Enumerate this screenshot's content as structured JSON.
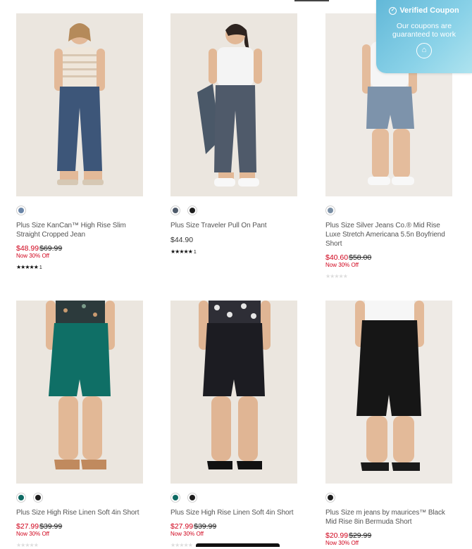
{
  "coupon": {
    "title": "Verified Coupon",
    "subtitle": "Our coupons are guaranteed to work",
    "check_icon": "check-circle-icon",
    "logo_icon": "shield-logo-icon"
  },
  "products": [
    {
      "title": "Plus Size KanCan™ High Rise Slim Straight Cropped Jean",
      "sale_price": "$48.99",
      "orig_price": "$69.99",
      "discount": "Now 30% Off",
      "stars": "★★★★★",
      "review_count": "1",
      "swatches": [
        "#6b86a8"
      ],
      "colors": {
        "top": "#efe6da",
        "bottom": "#3d5679",
        "skin": "#e3b998",
        "bg": "#ebe6df"
      }
    },
    {
      "title": "Plus Size Traveler Pull On Pant",
      "reg_price": "$44.90",
      "stars": "★★★★★",
      "review_count": "1",
      "swatches": [
        "#4f5b6b",
        "#1e1e1e"
      ],
      "colors": {
        "top": "#f4f4f4",
        "bottom": "#4f5a6a",
        "skin": "#e2b896",
        "bg": "#ebe6df"
      }
    },
    {
      "title": "Plus Size Silver Jeans Co.® Mid Rise Luxe Stretch Americana 5.5n Boyfriend Short",
      "sale_price": "$40.60",
      "orig_price": "$58.00",
      "discount": "Now 30% Off",
      "stars": "★★★★★",
      "swatches": [
        "#7a8fa5"
      ],
      "colors": {
        "top": "#f5f5f5",
        "bottom": "#7d93ab",
        "skin": "#e4bc9c",
        "bg": "#eeeae5"
      }
    },
    {
      "title": "Plus Size High Rise Linen Soft 4in Short",
      "sale_price": "$27.99",
      "orig_price": "$39.99",
      "discount": "Now 30% Off",
      "stars": "★★★★★",
      "swatches": [
        "#0e6a63",
        "#1e1e1e"
      ],
      "colors": {
        "top": "#2c3a3c",
        "bottom": "#0f6f66",
        "skin": "#e2b896",
        "bg": "#ebe6df"
      }
    },
    {
      "title": "Plus Size High Rise Linen Soft 4in Short",
      "sale_price": "$27.99",
      "orig_price": "$39.99",
      "discount": "Now 30% Off",
      "stars": "★★★★★",
      "swatches": [
        "#0e6a63",
        "#1e1e1e"
      ],
      "colors": {
        "top": "#2e2e36",
        "bottom": "#1c1c22",
        "skin": "#e0b594",
        "bg": "#ebe6df"
      }
    },
    {
      "title": "Plus Size m jeans by maurices™ Black Mid Rise 8in Bermuda Short",
      "sale_price": "$20.99",
      "orig_price": "$29.99",
      "discount": "Now 30% Off",
      "swatches": [
        "#1e1e1e"
      ],
      "colors": {
        "top": "#f6f6f6",
        "bottom": "#161616",
        "skin": "#e3ba99",
        "bg": "#eeeae5"
      }
    }
  ]
}
